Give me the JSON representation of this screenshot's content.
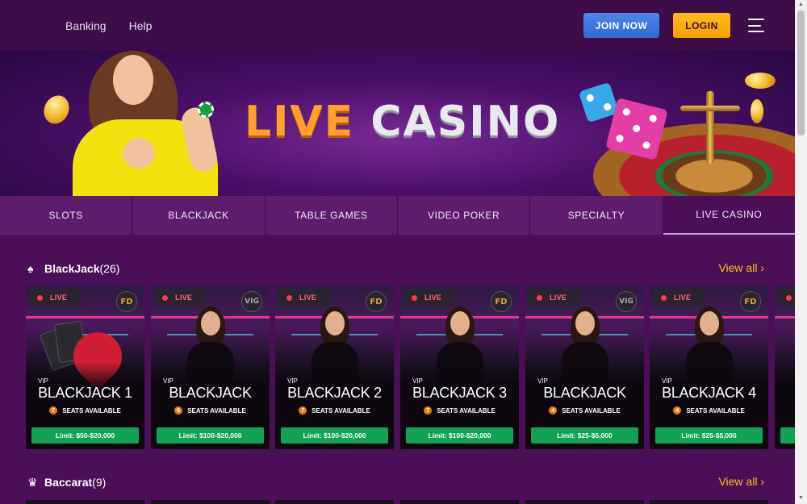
{
  "nav": {
    "links": [
      "Banking",
      "Help"
    ],
    "join_label": "JOIN NOW",
    "login_label": "LOGIN"
  },
  "hero": {
    "title_part1": "LIVE",
    "title_part2": "CASINO"
  },
  "tabs": [
    {
      "label": "SLOTS",
      "active": false
    },
    {
      "label": "BLACKJACK",
      "active": false
    },
    {
      "label": "TABLE GAMES",
      "active": false
    },
    {
      "label": "VIDEO POKER",
      "active": false
    },
    {
      "label": "SPECIALTY",
      "active": false
    },
    {
      "label": "LIVE CASINO",
      "active": true
    }
  ],
  "sections": [
    {
      "title": "BlackJack",
      "count": "(26)",
      "icon": "spade-icon",
      "view_all": "View all",
      "cards": [
        {
          "live": "LIVE",
          "provider": "FD",
          "vip": "VIP",
          "name": "BLACKJACK 1",
          "seats": "7",
          "seats_label": "SEATS AVAILABLE",
          "limit": "Limit: $50-$20,000",
          "scene": "cards"
        },
        {
          "live": "LIVE",
          "provider": "VIG",
          "vip": "VIP",
          "name": "BLACKJACK",
          "seats": "6",
          "seats_label": "SEATS AVAILABLE",
          "limit": "Limit: $100-$20,000",
          "scene": "dealer"
        },
        {
          "live": "LIVE",
          "provider": "FD",
          "vip": "VIP",
          "name": "BLACKJACK 2",
          "seats": "7",
          "seats_label": "SEATS AVAILABLE",
          "limit": "Limit: $100-$20,000",
          "scene": "dealer"
        },
        {
          "live": "LIVE",
          "provider": "FD",
          "vip": "VIP",
          "name": "BLACKJACK 3",
          "seats": "7",
          "seats_label": "SEATS AVAILABLE",
          "limit": "Limit: $100-$20,000",
          "scene": "dealer"
        },
        {
          "live": "LIVE",
          "provider": "VIG",
          "vip": "VIP",
          "name": "BLACKJACK",
          "seats": "4",
          "seats_label": "SEATS AVAILABLE",
          "limit": "Limit: $25-$5,000",
          "scene": "dealer"
        },
        {
          "live": "LIVE",
          "provider": "FD",
          "vip": "VIP",
          "name": "BLACKJACK 4",
          "seats": "4",
          "seats_label": "SEATS AVAILABLE",
          "limit": "Limit: $25-$5,000",
          "scene": "dealer"
        }
      ]
    },
    {
      "title": "Baccarat",
      "count": "(9)",
      "icon": "crown-icon",
      "view_all": "View all",
      "cards": []
    }
  ],
  "colors": {
    "background": "#4a0f57",
    "topbar": "#3d0c49",
    "join": "#3f76e0",
    "login": "#f9aa0c",
    "view_all": "#ffc21a",
    "limit": "#13a155",
    "live_dot": "#ff3a4f"
  }
}
